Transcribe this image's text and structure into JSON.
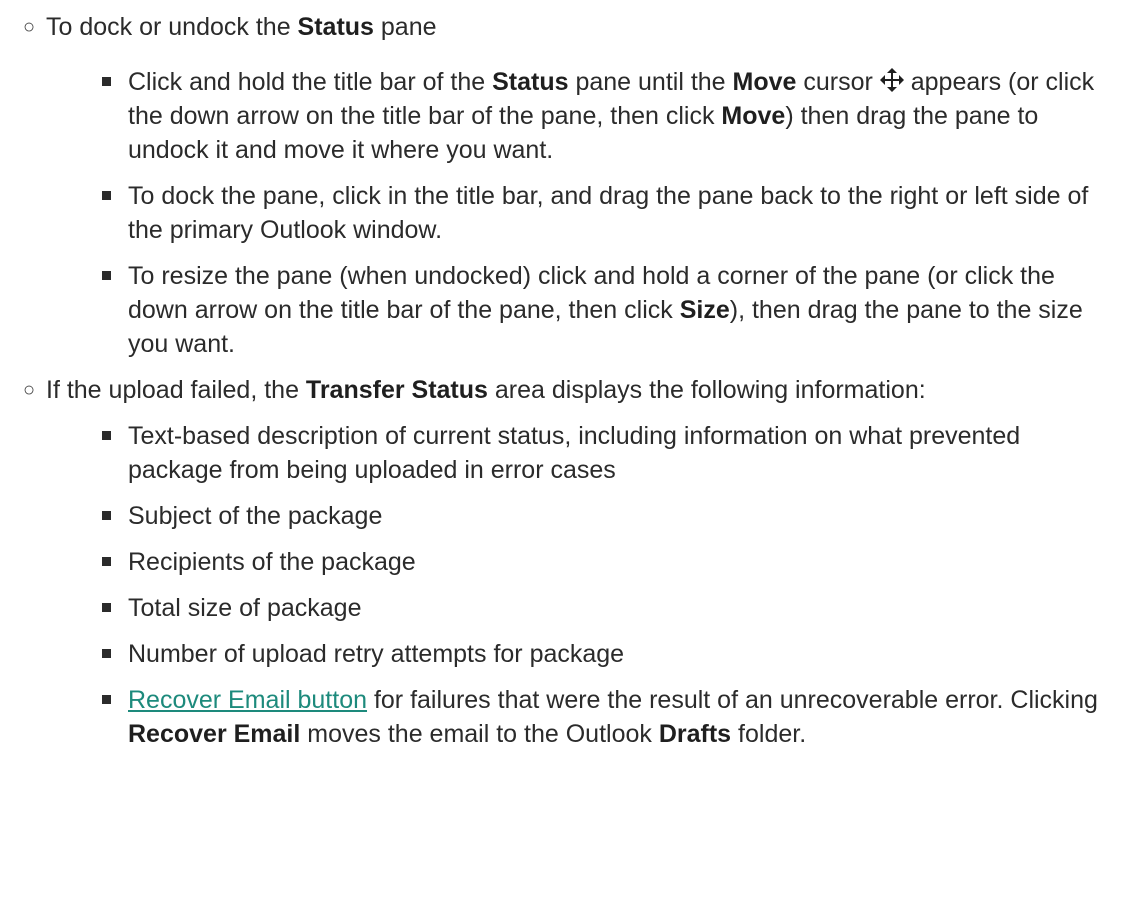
{
  "section_dock": {
    "heading_pre": "To dock or undock the ",
    "heading_bold": "Status",
    "heading_post": " pane",
    "items": [
      {
        "t1": "Click and hold the title bar of the ",
        "b1": "Status",
        "t2": " pane until the ",
        "b2": "Move",
        "t3": " cursor ",
        "t4": " appears (or click the down arrow on the title bar of the pane, then click ",
        "b3": "Move",
        "t5": ") then drag the pane to undock it and move it where you want."
      },
      {
        "text": "To dock the pane, click in the title bar, and drag the pane back to the right or left side of the primary Outlook window."
      },
      {
        "t1": "To resize the pane (when undocked) click and hold a corner of the pane (or click the down arrow on the title bar of the pane, then click ",
        "b1": "Size",
        "t2": "), then drag the pane to the size you want."
      }
    ],
    "move_cursor_icon": "move-cursor-icon"
  },
  "section_failed": {
    "heading_pre": "If the upload failed, the ",
    "heading_bold": "Transfer Status",
    "heading_post": " area displays the following information:",
    "items": [
      {
        "text": "Text-based description of current status, including information on what prevented package from being uploaded in error cases"
      },
      {
        "text": "Subject of the package"
      },
      {
        "text": "Recipients of the package"
      },
      {
        "text": "Total size of package"
      },
      {
        "text": "Number of upload retry attempts for package"
      },
      {
        "link": "Recover Email button",
        "t1": " for failures that were the result of an unrecoverable error. Clicking ",
        "b1": "Recover Email",
        "t2": " moves the email to the Outlook ",
        "b2": "Drafts",
        "t3": " folder."
      }
    ]
  },
  "colors": {
    "text": "#2b2b2b",
    "link": "#1d8a7c",
    "background": "#ffffff"
  }
}
